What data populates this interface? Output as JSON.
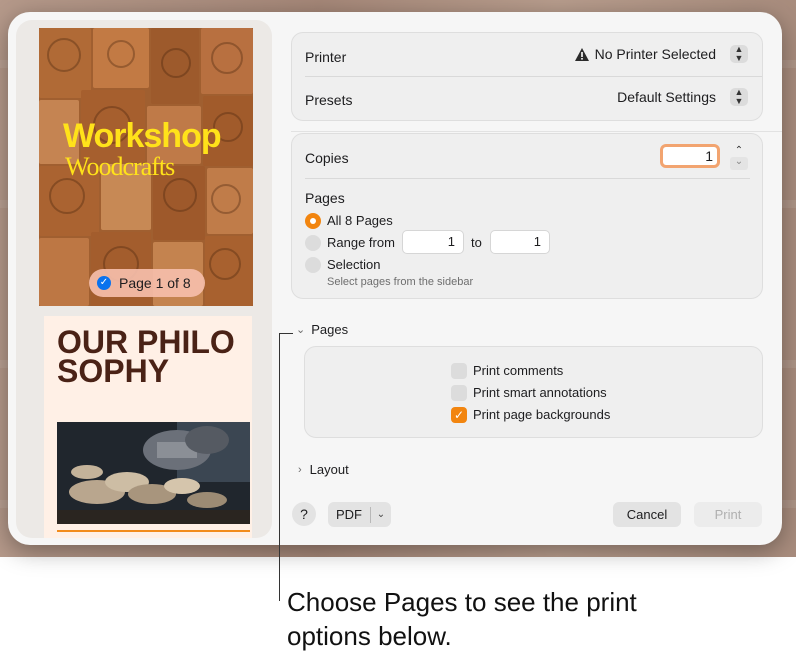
{
  "sidebar": {
    "cover": {
      "title": "Workshop",
      "subtitle": "Woodcrafts"
    },
    "page_badge": "Page 1 of 8",
    "page2": {
      "heading": "OUR PHILOSOPHY"
    }
  },
  "printer": {
    "label": "Printer",
    "value": "No Printer Selected",
    "warning_icon": "warning-icon"
  },
  "presets": {
    "label": "Presets",
    "value": "Default Settings"
  },
  "copies": {
    "label": "Copies",
    "value": "1"
  },
  "pages": {
    "heading": "Pages",
    "all_label": "All 8 Pages",
    "range_label": "Range from",
    "range_from": "1",
    "range_to_label": "to",
    "range_to": "1",
    "selection_label": "Selection",
    "selection_hint": "Select pages from the sidebar",
    "selected": "all"
  },
  "pages_section": {
    "label": "Pages",
    "expanded": true,
    "options": [
      {
        "label": "Print comments",
        "checked": false
      },
      {
        "label": "Print smart annotations",
        "checked": false
      },
      {
        "label": "Print page backgrounds",
        "checked": true
      }
    ]
  },
  "layout_section": {
    "label": "Layout",
    "expanded": false
  },
  "footer": {
    "help_label": "?",
    "pdf_label": "PDF",
    "cancel_label": "Cancel",
    "print_label": "Print"
  },
  "callout": {
    "text": "Choose Pages to see the print options below."
  },
  "colors": {
    "accent": "#f2850f",
    "focus_ring": "#f2a470",
    "selected_blue": "#0a72ee"
  }
}
